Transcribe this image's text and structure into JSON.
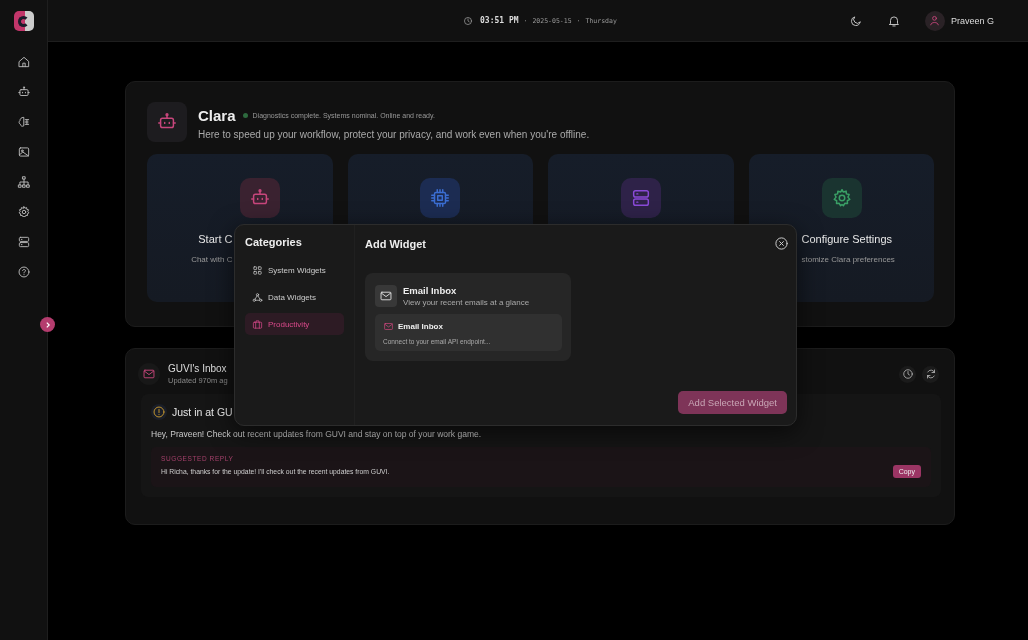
{
  "sidebar": {
    "items": [
      {
        "kind": "home"
      },
      {
        "kind": "robot"
      },
      {
        "kind": "brain"
      },
      {
        "kind": "image"
      },
      {
        "kind": "network"
      },
      {
        "kind": "gear"
      },
      {
        "kind": "server"
      },
      {
        "kind": "help"
      }
    ]
  },
  "header": {
    "time": "03:51 PM",
    "separators": [
      "·",
      "·"
    ],
    "date": "2025-05-15",
    "day": "Thursday",
    "user": "Praveen G"
  },
  "assistant": {
    "name": "Clara",
    "status": "Diagnostics complete. Systems nominal. Online and ready.",
    "tagline": "Here to speed up your workflow, protect your privacy, and work even when you're offline.",
    "actions": [
      {
        "kind": "robot",
        "title": "Start C",
        "subtitle": "Chat with C"
      },
      {
        "kind": "chip"
      },
      {
        "kind": "server"
      },
      {
        "kind": "gear",
        "title": "Configure Settings",
        "subtitle": "stomize Clara preferences"
      }
    ]
  },
  "inbox": {
    "title": "GUVI's Inbox",
    "updated": "Updated 970m ag",
    "alert": "Just in at GU",
    "message": "Hey, Praveen! Check out recent updates from GUVI and stay on top of your work game.",
    "suggested_label": "SUGGESTED REPLY",
    "reply": "Hi Richa, thanks for the update! I'll check out the recent updates from GUVI.",
    "copy_button": "Copy"
  },
  "modal": {
    "categories_title": "Categories",
    "categories": [
      {
        "label": "System Widgets",
        "kind": "grid",
        "selected": false
      },
      {
        "label": "Data Widgets",
        "kind": "webhook",
        "selected": false
      },
      {
        "label": "Productivity",
        "kind": "briefcase",
        "selected": true
      }
    ],
    "title": "Add Widget",
    "widget": {
      "title": "Email Inbox",
      "description": "View your recent emails at a glance"
    },
    "option": {
      "title": "Email Inbox",
      "description": "Connect to your email API endpoint..."
    },
    "add_button": "Add Selected Widget"
  }
}
